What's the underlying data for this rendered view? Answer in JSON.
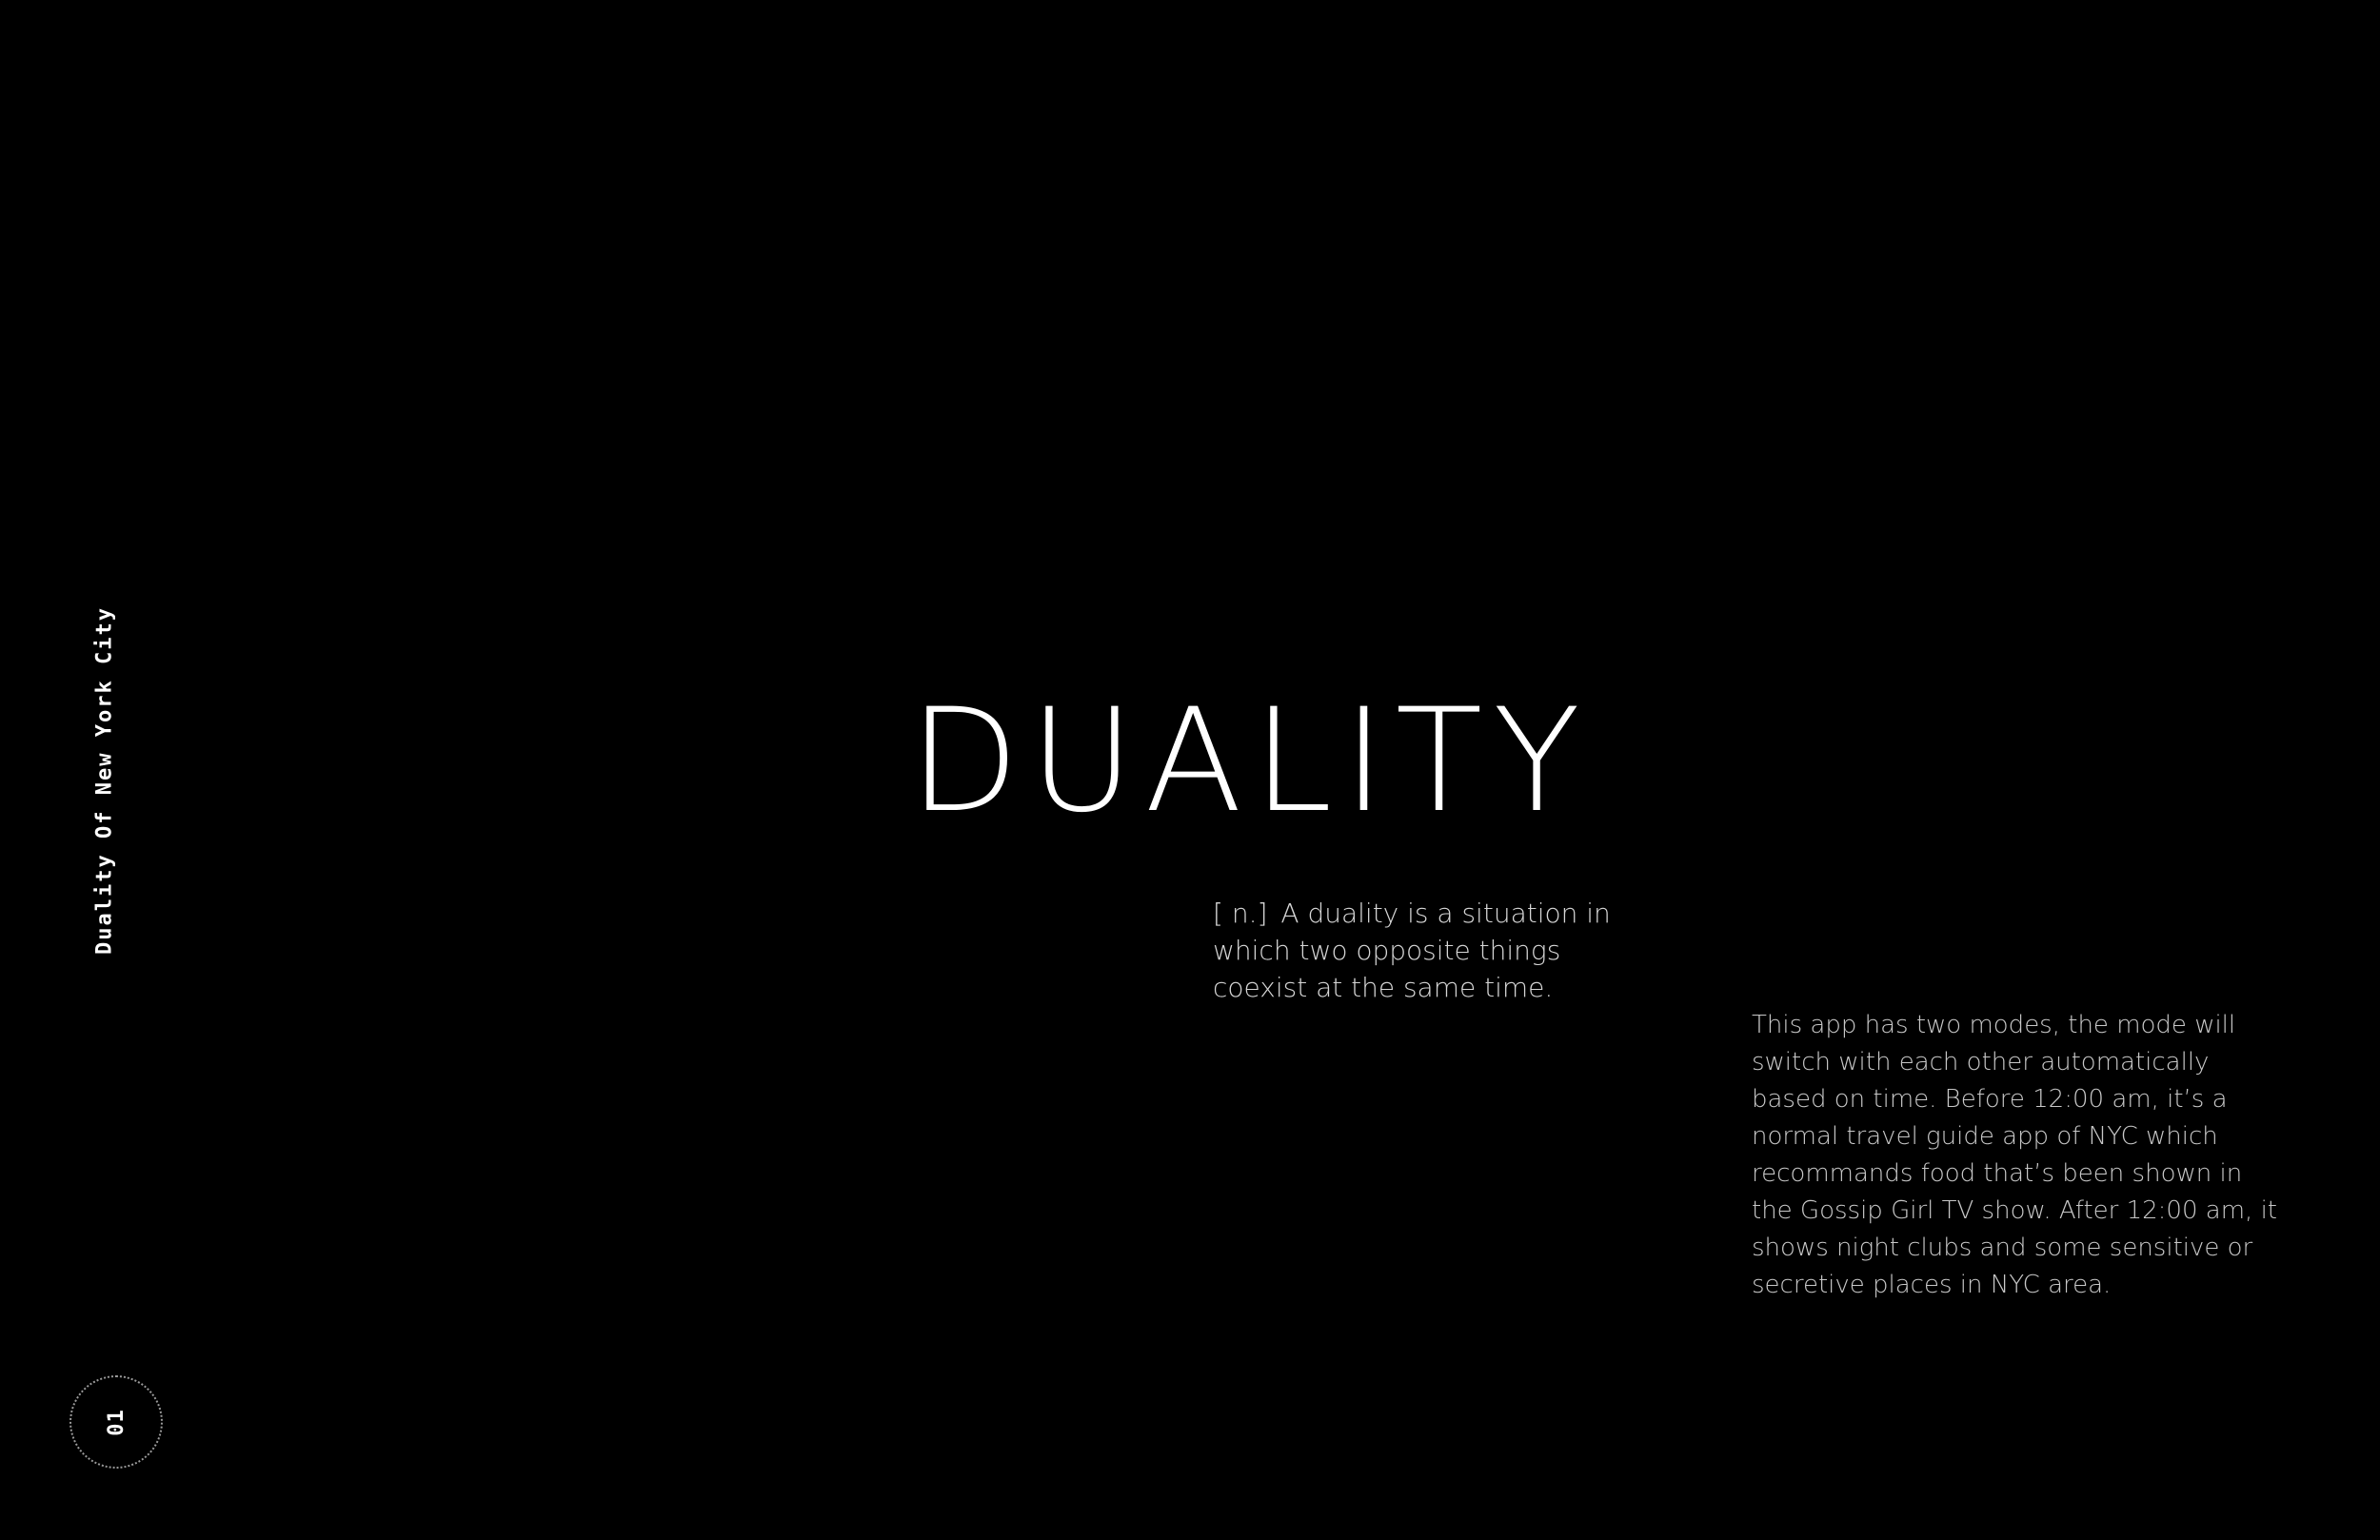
{
  "side_label": "Duality Of New York City",
  "page_number": "01",
  "headline": "DUALITY",
  "definition": {
    "part_of_speech": "[ n.]",
    "text": "A duality is a situation in which two opposite things coexist at the same time."
  },
  "description": "This app has two modes, the mode will switch with each other automatically based on time. Before 12:00 am, it’s a normal travel guide app of NYC which recommands food that’s been shown in the Gossip Girl TV show. After 12:00 am, it shows night clubs and some sensitive or secretive places in NYC area.",
  "colors": {
    "background": "#000000",
    "text": "#ffffff",
    "badge_border": "#9a9a9a"
  }
}
